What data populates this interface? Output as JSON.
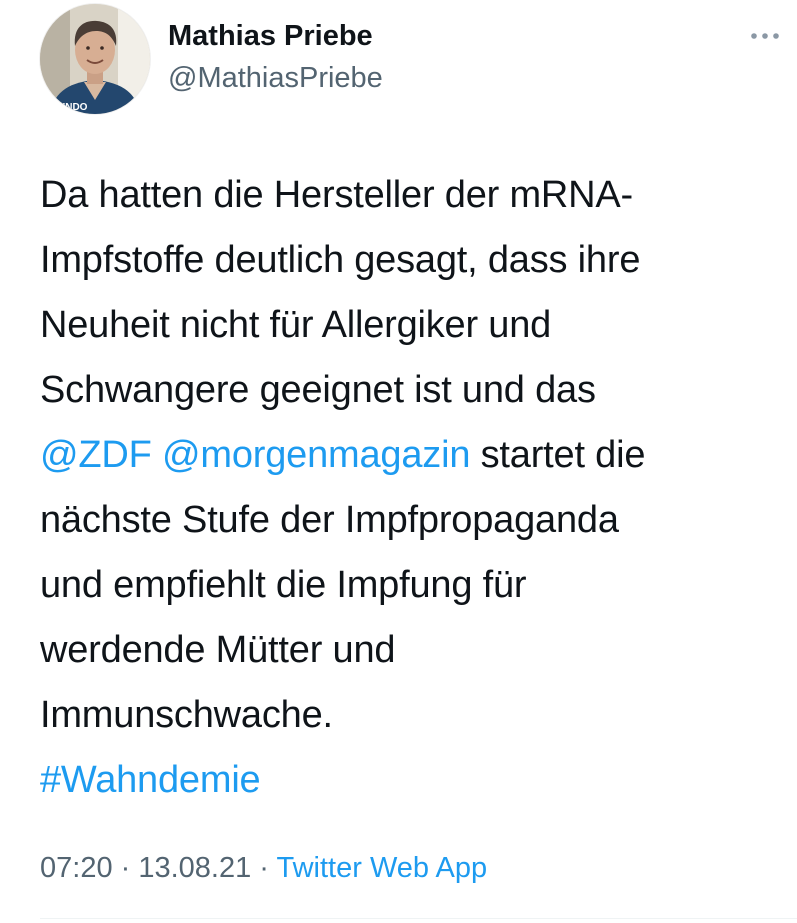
{
  "author": {
    "display_name": "Mathias Priebe",
    "handle": "@MathiasPriebe",
    "avatar_icon": "profile-photo",
    "shirt_text": "UNDO"
  },
  "menu": {
    "icon": "more-horizontal-icon"
  },
  "tweet": {
    "lines": [
      [
        {
          "text": "Da hatten die Hersteller der mRNA-",
          "link": false
        }
      ],
      [
        {
          "text": "Impfstoffe deutlich gesagt, dass ihre",
          "link": false
        }
      ],
      [
        {
          "text": "Neuheit nicht für Allergiker und",
          "link": false
        }
      ],
      [
        {
          "text": "Schwangere geeignet ist und das",
          "link": false
        }
      ],
      [
        {
          "text": "@ZDF @morgenmagazin",
          "link": true
        },
        {
          "text": " startet die",
          "link": false
        }
      ],
      [
        {
          "text": "nächste Stufe der Impfpropaganda",
          "link": false
        }
      ],
      [
        {
          "text": "und empfiehlt die Impfung für",
          "link": false
        }
      ],
      [
        {
          "text": "werdende Mütter und",
          "link": false
        }
      ],
      [
        {
          "text": "Immunschwache.",
          "link": false
        }
      ],
      [
        {
          "text": "#Wahndemie",
          "link": true
        }
      ]
    ]
  },
  "meta": {
    "time": "07:20",
    "separator": " · ",
    "date": "13.08.21",
    "source": "Twitter Web App"
  },
  "colors": {
    "link": "#1d9bf0",
    "secondary_text": "#536471",
    "primary_text": "#0f1419"
  }
}
